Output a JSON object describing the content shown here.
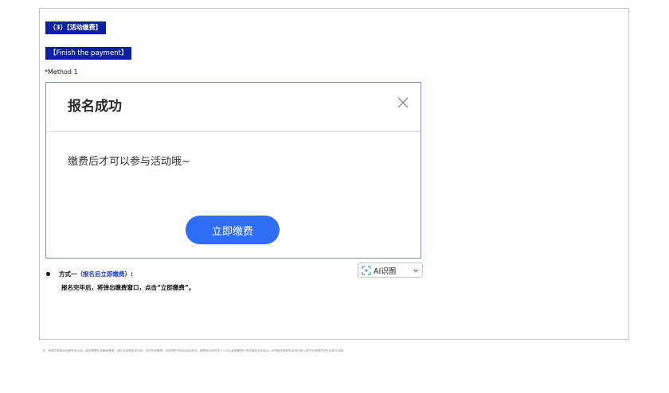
{
  "section_tag_cn": "（3）【活动缴费】",
  "section_tag_en": "【Finish the payment】",
  "method_label": "*Method 1",
  "modal": {
    "title": "报名成功",
    "message": "缴费后才可以参与活动哦~",
    "button_label": "立即缴费",
    "close_icon": "close-icon"
  },
  "bullet": {
    "prefix": "方式一（",
    "highlight": "报名后立即缴费",
    "suffix": "）:",
    "detail": "报名完毕后，将弹出缴费窗口，点击“立即缴费”。"
  },
  "ai_chip": {
    "label": "AI识图",
    "icon": "ai-scan-icon"
  },
  "footnote": "注：管理员审核活动报名信息后，若您需要在线缴纳费用，请在活动报名成功后，及时完成缴费，否则将影响您的活动参与。缴费成功后可在个人中心查看缴费记录及相关凭证信息。如有疑问请联系活动负责人或平台管理员进行咨询与处理。"
}
